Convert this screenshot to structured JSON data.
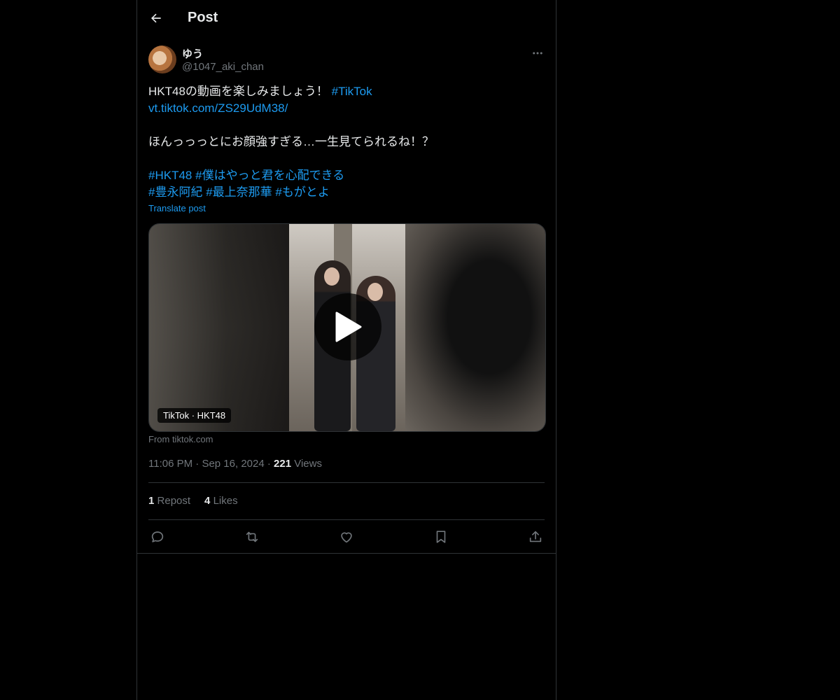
{
  "header": {
    "title": "Post"
  },
  "author": {
    "name": "ゆう",
    "handle": "@1047_aki_chan"
  },
  "post": {
    "line1_text": "HKT48の動画を楽しみましょう！ ",
    "line1_hashtag": "#TikTok",
    "link": "vt.tiktok.com/ZS29UdM38/",
    "line3": "ほんっっっとにお顔強すぎる…一生見てられるね！？",
    "hashtags_row1": [
      "#HKT48",
      "#僕はやっと君を心配できる"
    ],
    "hashtags_row2": [
      "#豊永阿紀",
      "#最上奈那華",
      "#もがとよ"
    ],
    "translate": "Translate post"
  },
  "media": {
    "badge": "TikTok · HKT48",
    "source": "From tiktok.com"
  },
  "meta": {
    "time": "11:06 PM",
    "sep": "·",
    "date": "Sep 16, 2024",
    "views_count": "221",
    "views_label": "Views"
  },
  "stats": {
    "reposts_count": "1",
    "reposts_label": "Repost",
    "likes_count": "4",
    "likes_label": "Likes"
  },
  "icons": {
    "back": "arrow-left-icon",
    "more": "more-horizontal-icon",
    "reply": "reply-icon",
    "repost": "repost-icon",
    "like": "heart-icon",
    "bookmark": "bookmark-icon",
    "share": "share-icon",
    "play": "play-icon"
  },
  "colors": {
    "background": "#000000",
    "text": "#e7e9ea",
    "muted": "#71767b",
    "link": "#1d9bf0",
    "border": "#2f3336"
  }
}
